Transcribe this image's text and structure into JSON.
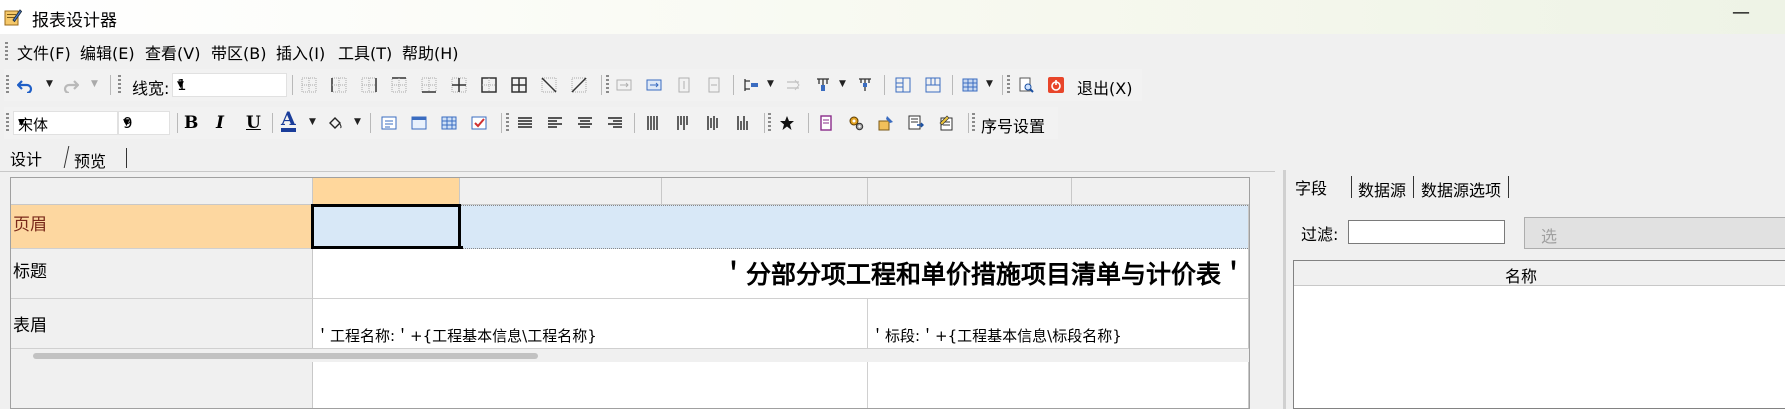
{
  "window": {
    "title": "报表设计器",
    "minimize": "—"
  },
  "menu": [
    "文件(F)",
    "编辑(E)",
    "查看(V)",
    "带区(B)",
    "插入(I)",
    "工具(T)",
    "帮助(H)"
  ],
  "toolbar1": {
    "linewidth_label": "线宽:",
    "linewidth_value": "1",
    "exit_label": "退出(X)"
  },
  "toolbar2": {
    "font_name": "宋体",
    "font_size": "9",
    "bold": "B",
    "italic": "I",
    "underline": "U",
    "font_color_glyph": "A",
    "serial_label": "序号设置"
  },
  "tabs": [
    "设计",
    "预览"
  ],
  "grid": {
    "rows": [
      {
        "label": "页眉"
      },
      {
        "label": "标题"
      },
      {
        "label": "表眉"
      }
    ],
    "title_text": "＇分部分项工程和单价措施项目清单与计价表＇",
    "project_name_text": "＇工程名称:＇+{工程基本信息\\工程名称}",
    "section_text": "＇标段:＇+{工程基本信息\\标段名称}"
  },
  "rightpanel": {
    "tabs": [
      "字段",
      "数据源",
      "数据源选项"
    ],
    "filter_label": "过滤:",
    "filter_value": "",
    "button_label": "选",
    "column_header": "名称"
  },
  "colors": {
    "selected_header": "#ffd79c",
    "row_highlight": "#fdd7a0",
    "band_fill": "#d8e8f7"
  }
}
